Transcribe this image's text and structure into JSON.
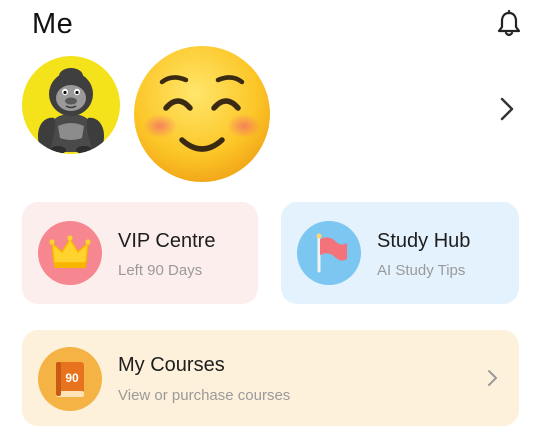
{
  "header": {
    "title": "Me",
    "notification_icon": "bell-icon"
  },
  "profile": {
    "avatar_icon": "gorilla-avatar",
    "mood_icon": "smiling-face-emoji",
    "chevron_icon": "chevron-right-icon"
  },
  "cards": {
    "vip": {
      "title": "VIP Centre",
      "subtitle": "Left 90 Days",
      "icon": "crown-icon",
      "background": "#fdeeee"
    },
    "study": {
      "title": "Study Hub",
      "subtitle": "AI Study Tips",
      "icon": "flag-icon",
      "background": "#e3f2fc"
    },
    "courses": {
      "title": "My Courses",
      "subtitle": "View or purchase courses",
      "icon": "book-icon",
      "book_label": "90",
      "background": "#fdf1dc"
    }
  }
}
